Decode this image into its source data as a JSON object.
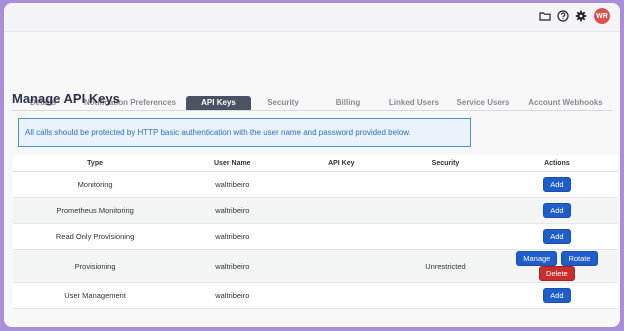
{
  "topbar": {
    "icons": [
      "folder-icon",
      "help-icon",
      "gear-icon"
    ],
    "avatar_initials": "WR"
  },
  "tabs": [
    {
      "label": "Details"
    },
    {
      "label": "Notification Preferences"
    },
    {
      "label": "API Keys",
      "active": true
    },
    {
      "label": "Security"
    },
    {
      "label": "Billing"
    },
    {
      "label": "Linked Users"
    },
    {
      "label": "Service Users"
    },
    {
      "label": "Account Webhooks"
    }
  ],
  "page": {
    "title": "Manage API Keys",
    "notice": "All calls should be protected by HTTP basic authentication with the user name and password provided below."
  },
  "table": {
    "headers": [
      "Type",
      "User Name",
      "API Key",
      "Security",
      "Actions"
    ],
    "rows": [
      {
        "type": "Monitoring",
        "user": "waltribeiro",
        "api_key": "",
        "security": "",
        "actions": [
          "Add"
        ]
      },
      {
        "type": "Prometheus Monitoring",
        "user": "waltribeiro",
        "api_key": "",
        "security": "",
        "actions": [
          "Add"
        ]
      },
      {
        "type": "Read Only Provisioning",
        "user": "waltribeiro",
        "api_key": "",
        "security": "",
        "actions": [
          "Add"
        ]
      },
      {
        "type": "Provisioning",
        "user": "waltribeiro",
        "api_key": "",
        "security": "Unrestricted",
        "actions": [
          "Manage",
          "Rotate",
          "Delete"
        ]
      },
      {
        "type": "User Management",
        "user": "waltribeiro",
        "api_key": "",
        "security": "",
        "actions": [
          "Add"
        ]
      }
    ]
  },
  "colors": {
    "accent": "#1f5dc9",
    "danger": "#c72f2f",
    "active_tab": "#4a5263",
    "avatar": "#d9534f"
  }
}
